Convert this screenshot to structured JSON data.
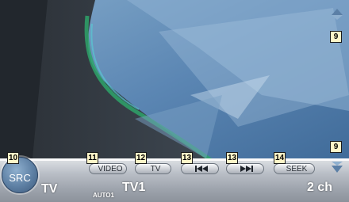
{
  "status": {
    "mode": "TV",
    "auto": "AUTO1",
    "band": "TV1",
    "channel": "2 ch"
  },
  "buttons": {
    "src": "SRC",
    "video": "VIDEO",
    "tv": "TV",
    "seek": "SEEK"
  },
  "callouts": {
    "src": "10",
    "video": "11",
    "tv": "12",
    "prev": "13",
    "next": "13",
    "seek": "14",
    "scroll_up": "9",
    "scroll_down": "9"
  },
  "icons": {
    "prev": "skip-previous-icon",
    "next": "skip-next-icon",
    "up": "up-arrow-icon",
    "down": "down-arrow-icon"
  }
}
